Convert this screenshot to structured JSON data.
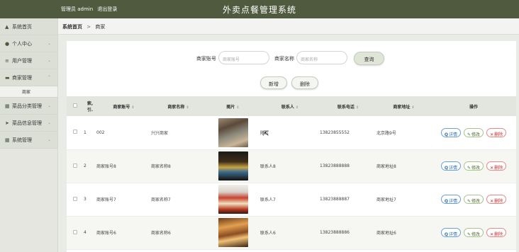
{
  "header": {
    "user_label": "管理员 admin",
    "logout_label": "退出登录",
    "app_title": "外卖点餐管理系统"
  },
  "sidebar": {
    "items": [
      {
        "label": "系统首页",
        "icon": "home-icon",
        "glyph": "▲",
        "has_chevron": false
      },
      {
        "label": "个人中心",
        "icon": "user-icon",
        "glyph": "●",
        "has_chevron": true
      },
      {
        "label": "用户管理",
        "icon": "sliders-icon",
        "glyph": "≡",
        "has_chevron": true
      },
      {
        "label": "商家管理",
        "icon": "shop-icon",
        "glyph": "▬",
        "has_chevron": true,
        "expanded": true
      },
      {
        "label": "菜品分类管理",
        "icon": "grid-icon",
        "glyph": "▦",
        "has_chevron": true
      },
      {
        "label": "菜品信息管理",
        "icon": "send-icon",
        "glyph": "➤",
        "has_chevron": true
      },
      {
        "label": "系统管理",
        "icon": "grid-icon",
        "glyph": "▦",
        "has_chevron": true
      }
    ],
    "sub_item": "商家"
  },
  "breadcrumb": {
    "home": "系统首页",
    "separator": ">",
    "current": "商家"
  },
  "search": {
    "account_label": "商家账号",
    "account_placeholder": "商家账号",
    "name_label": "商家名称",
    "name_placeholder": "商家名称",
    "query_button": "查询"
  },
  "actions": {
    "add": "新增",
    "delete": "删除"
  },
  "table": {
    "headers": [
      "索引",
      "商家账号",
      "商家名称",
      "图片",
      "联系人",
      "联系电话",
      "商家地址",
      "操作"
    ],
    "index_header_lines": [
      "索",
      "引"
    ],
    "rows": [
      {
        "index": "1",
        "account": "002",
        "name": "兴兴商家",
        "contact": "陈红",
        "phone": "13823855552",
        "address": "北京路9号"
      },
      {
        "index": "2",
        "account": "商家账号8",
        "name": "商家名称8",
        "contact": "联系人8",
        "phone": "13823888888",
        "address": "商家地址8"
      },
      {
        "index": "3",
        "account": "商家账号7",
        "name": "商家名称7",
        "contact": "联系人7",
        "phone": "13823888887",
        "address": "商家地址7"
      },
      {
        "index": "4",
        "account": "商家账号6",
        "name": "商家名称6",
        "contact": "联系人6",
        "phone": "13823888886",
        "address": "商家地址6"
      }
    ],
    "op_labels": {
      "detail": "详情",
      "edit": "修改",
      "delete": "删除"
    }
  },
  "colors": {
    "topbar": "#4f5a3f",
    "sidebar": "#dcdfd6",
    "table_header": "#e3e5df",
    "detail": "#2e6fb0",
    "edit": "#4a6a2c",
    "delete": "#c02c2c"
  }
}
